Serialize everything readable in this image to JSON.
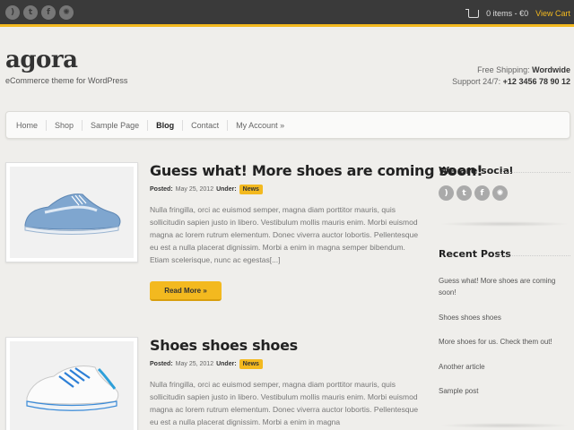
{
  "topbar": {
    "social_icons": [
      "rss-icon",
      "twitter-icon",
      "facebook-icon",
      "dribbble-icon"
    ],
    "cart_text": "0 items - €0",
    "view_cart": "View Cart"
  },
  "header": {
    "logo": "agora",
    "tagline": "eCommerce theme for WordPress",
    "shipping_label": "Free Shipping:",
    "shipping_value": "Wordwide",
    "support_label": "Support 24/7:",
    "support_value": "+12 3456 78 90 12"
  },
  "nav": [
    "Home",
    "Shop",
    "Sample Page",
    "Blog",
    "Contact",
    "My Account »"
  ],
  "nav_active": "Blog",
  "posts": [
    {
      "title": "Guess what! More shoes are coming soon!",
      "posted_label": "Posted:",
      "date": "May 25, 2012",
      "under_label": "Under:",
      "category": "News",
      "excerpt": "Nulla fringilla, orci ac euismod semper, magna diam porttitor mauris, quis sollicitudin sapien justo in libero. Vestibulum mollis mauris enim. Morbi euismod magna ac lorem rutrum elementum. Donec viverra auctor lobortis. Pellentesque eu est a nulla placerat dignissim. Morbi a enim in magna semper bibendum. Etiam scelerisque, nunc ac egestas[...]",
      "read_more": "Read More »"
    },
    {
      "title": "Shoes shoes shoes",
      "posted_label": "Posted:",
      "date": "May 25, 2012",
      "under_label": "Under:",
      "category": "News",
      "excerpt": "Nulla fringilla, orci ac euismod semper, magna diam porttitor mauris, quis sollicitudin sapien justo in libero. Vestibulum mollis mauris enim. Morbi euismod magna ac lorem rutrum elementum. Donec viverra auctor lobortis. Pellentesque eu est a nulla placerat dignissim. Morbi a enim in magna"
    }
  ],
  "sidebar": {
    "social_title": "We are social",
    "social_icons": [
      "rss-icon",
      "twitter-icon",
      "facebook-icon",
      "dribbble-icon"
    ],
    "recent_title": "Recent Posts",
    "recent": [
      "Guess what! More shoes are coming soon!",
      "Shoes shoes shoes",
      "More shoes for us. Check them out!",
      "Another article",
      "Sample post"
    ]
  },
  "colors": {
    "accent": "#f3b91f",
    "topbar": "#3a3a3a",
    "background": "#efeeeb"
  }
}
